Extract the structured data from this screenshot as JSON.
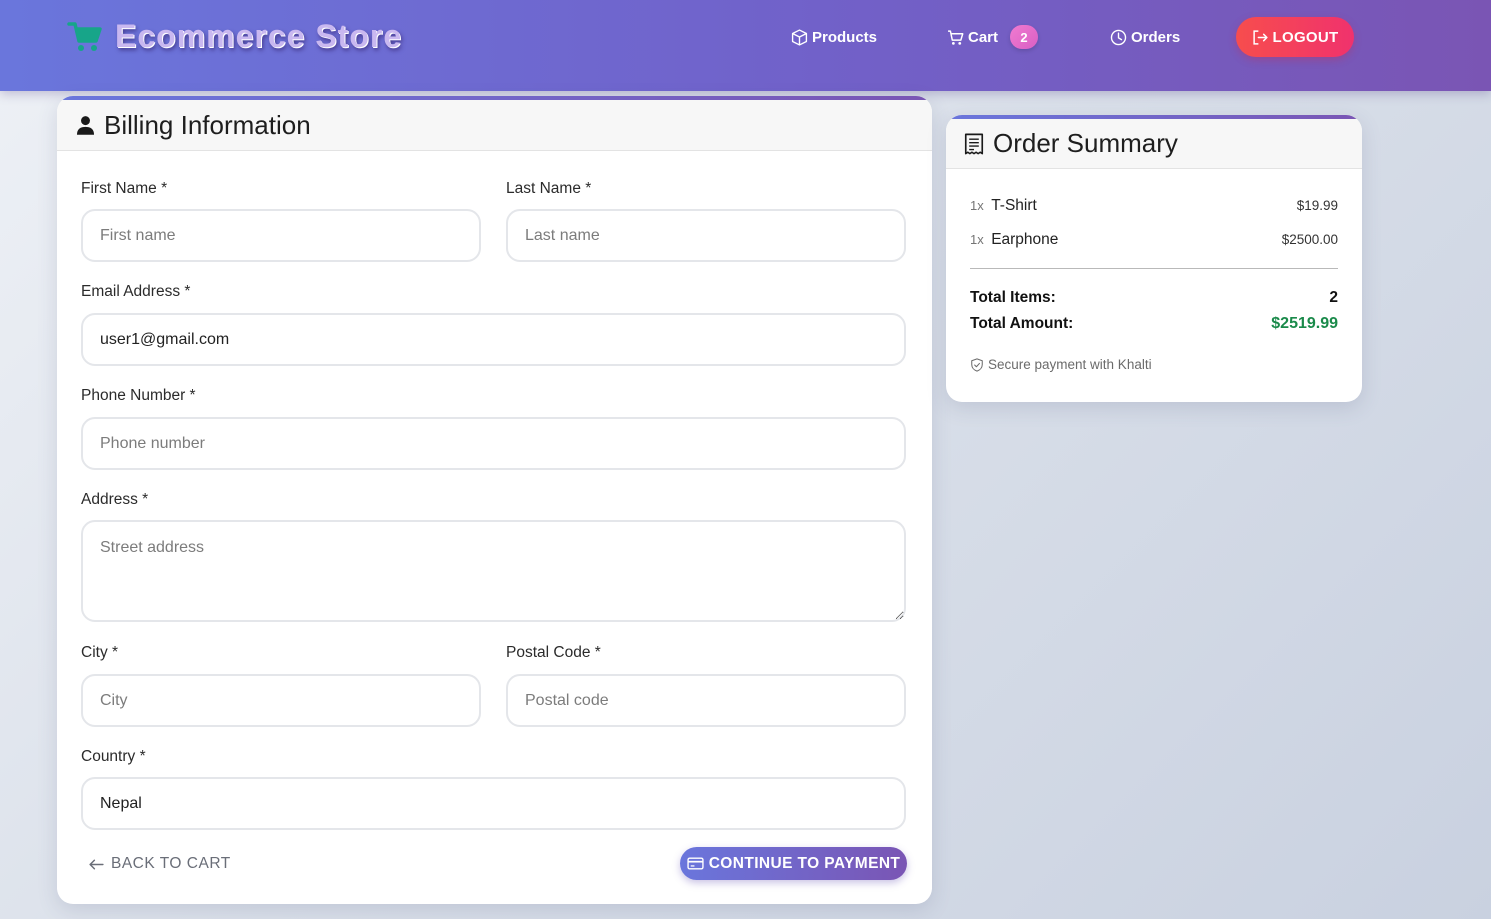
{
  "header": {
    "brand": "Ecommerce Store",
    "nav": {
      "products": "Products",
      "cart": "Cart",
      "cart_count": "2",
      "orders": "Orders",
      "logout": "LOGOUT"
    }
  },
  "billing": {
    "title": "Billing Information",
    "first_name": {
      "label": "First Name *",
      "placeholder": "First name",
      "value": ""
    },
    "last_name": {
      "label": "Last Name *",
      "placeholder": "Last name",
      "value": ""
    },
    "email": {
      "label": "Email Address *",
      "placeholder": "",
      "value": "user1@gmail.com"
    },
    "phone": {
      "label": "Phone Number *",
      "placeholder": "Phone number",
      "value": ""
    },
    "address": {
      "label": "Address *",
      "placeholder": "Street address",
      "value": ""
    },
    "city": {
      "label": "City *",
      "placeholder": "City",
      "value": ""
    },
    "postal_code": {
      "label": "Postal Code *",
      "placeholder": "Postal code",
      "value": ""
    },
    "country": {
      "label": "Country *",
      "placeholder": "",
      "value": "Nepal"
    },
    "back_label": "BACK TO CART",
    "continue_label": "CONTINUE TO PAYMENT"
  },
  "summary": {
    "title": "Order Summary",
    "items": [
      {
        "qty": "1x",
        "name": "T-Shirt",
        "price": "$19.99"
      },
      {
        "qty": "1x",
        "name": "Earphone",
        "price": "$2500.00"
      }
    ],
    "total_items_label": "Total Items:",
    "total_items_value": "2",
    "total_amount_label": "Total Amount:",
    "total_amount_value": "$2519.99",
    "secure_text": "Secure payment with Khalti"
  },
  "colors": {
    "header_gradient_start": "#6a76dc",
    "header_gradient_end": "#7a55b4",
    "logout": "#f74d4d",
    "total_amount": "#1a8a4a",
    "cart_badge": "#f07bd0"
  },
  "icons": {
    "brand": "cart-icon",
    "products": "box-icon",
    "cart": "cart-icon",
    "orders": "clock-icon",
    "logout": "logout-icon",
    "billing": "person-icon",
    "summary": "receipt-icon",
    "back": "arrow-left-icon",
    "continue": "credit-card-icon",
    "secure": "shield-icon"
  }
}
